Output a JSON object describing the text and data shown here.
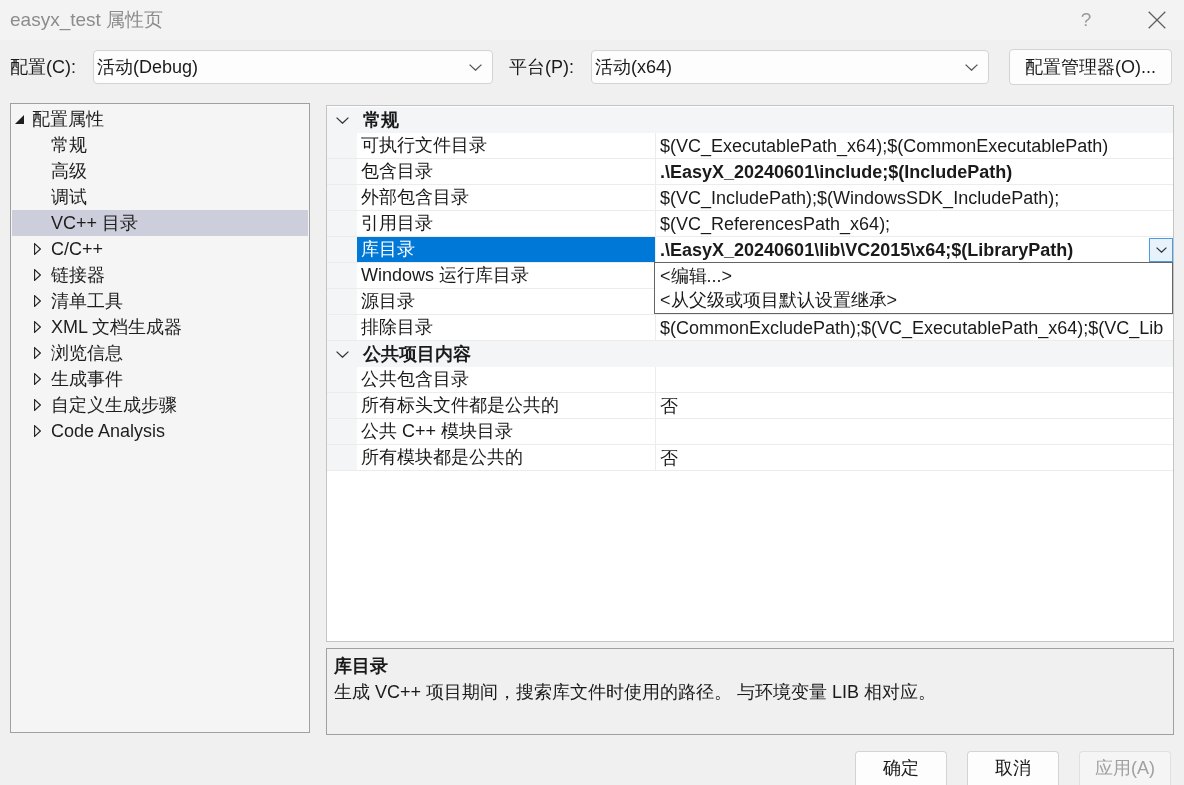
{
  "window": {
    "title": "easyx_test 属性页",
    "help_button": "?"
  },
  "toolbar": {
    "configuration": {
      "label": "配置(C):",
      "value": "活动(Debug)"
    },
    "platform": {
      "label": "平台(P):",
      "value": "活动(x64)"
    },
    "manager_button": "配置管理器(O)..."
  },
  "tree": [
    {
      "label": "配置属性",
      "kind": "group",
      "expanded": true,
      "selected": false,
      "children": [
        {
          "label": "常规",
          "kind": "leaf",
          "selected": false
        },
        {
          "label": "高级",
          "kind": "leaf",
          "selected": false
        },
        {
          "label": "调试",
          "kind": "leaf",
          "selected": false
        },
        {
          "label": "VC++ 目录",
          "kind": "leaf",
          "selected": true
        },
        {
          "label": "C/C++",
          "kind": "group",
          "expanded": false,
          "selected": false
        },
        {
          "label": "链接器",
          "kind": "group",
          "expanded": false,
          "selected": false
        },
        {
          "label": "清单工具",
          "kind": "group",
          "expanded": false,
          "selected": false
        },
        {
          "label": "XML 文档生成器",
          "kind": "group",
          "expanded": false,
          "selected": false
        },
        {
          "label": "浏览信息",
          "kind": "group",
          "expanded": false,
          "selected": false
        },
        {
          "label": "生成事件",
          "kind": "group",
          "expanded": false,
          "selected": false
        },
        {
          "label": "自定义生成步骤",
          "kind": "group",
          "expanded": false,
          "selected": false
        },
        {
          "label": "Code Analysis",
          "kind": "group",
          "expanded": false,
          "selected": false
        }
      ]
    }
  ],
  "grid": {
    "categories": [
      {
        "title": "常规",
        "expanded": true,
        "rows": [
          {
            "name": "可执行文件目录",
            "value": "$(VC_ExecutablePath_x64);$(CommonExecutablePath)",
            "bold": false,
            "selected": false
          },
          {
            "name": "包含目录",
            "value": ".\\EasyX_20240601\\include;$(IncludePath)",
            "bold": true,
            "selected": false
          },
          {
            "name": "外部包含目录",
            "value": "$(VC_IncludePath);$(WindowsSDK_IncludePath);",
            "bold": false,
            "selected": false
          },
          {
            "name": "引用目录",
            "value": "$(VC_ReferencesPath_x64);",
            "bold": false,
            "selected": false
          },
          {
            "name": "库目录",
            "value": ".\\EasyX_20240601\\lib\\VC2015\\x64;$(LibraryPath)",
            "bold": true,
            "selected": true,
            "menu": [
              "<编辑...>",
              "<从父级或项目默认设置继承>"
            ]
          },
          {
            "name": "Windows 运行库目录",
            "selected": false
          },
          {
            "name": "源目录",
            "selected": false
          },
          {
            "name": "排除目录",
            "value": "$(CommonExcludePath);$(VC_ExecutablePath_x64);$(VC_Lib",
            "bold": false,
            "selected": false
          }
        ]
      },
      {
        "title": "公共项目内容",
        "expanded": true,
        "rows": [
          {
            "name": "公共包含目录",
            "selected": false
          },
          {
            "name": "所有标头文件都是公共的",
            "value": "否",
            "bold": false,
            "selected": false
          },
          {
            "name": "公共 C++ 模块目录",
            "selected": false
          },
          {
            "name": "所有模块都是公共的",
            "value": "否",
            "bold": false,
            "selected": false
          }
        ]
      }
    ]
  },
  "description": {
    "title": "库目录",
    "text": "生成 VC++ 项目期间，搜索库文件时使用的路径。 与环境变量 LIB 相对应。"
  },
  "buttons": [
    {
      "label": "确定",
      "disabled": false
    },
    {
      "label": "取消",
      "disabled": false
    },
    {
      "label": "应用(A)",
      "disabled": true
    }
  ]
}
